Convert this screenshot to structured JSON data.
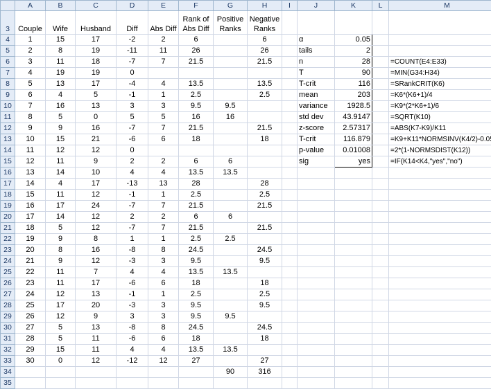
{
  "columns": [
    "A",
    "B",
    "C",
    "D",
    "E",
    "F",
    "G",
    "H",
    "I",
    "J",
    "K",
    "L",
    "M"
  ],
  "header_row": {
    "num": "3",
    "cells": [
      "Couple",
      "Wife",
      "Husband",
      "Diff",
      "Abs Diff",
      "Rank of Abs Diff",
      "Positive Ranks",
      "Negative Ranks",
      "",
      "",
      "",
      "",
      ""
    ]
  },
  "rows": [
    {
      "num": "4",
      "cells": [
        "1",
        "15",
        "17",
        "-2",
        "2",
        "6",
        "",
        "6",
        "",
        "α",
        "0.05",
        "",
        ""
      ]
    },
    {
      "num": "5",
      "cells": [
        "2",
        "8",
        "19",
        "-11",
        "11",
        "26",
        "",
        "26",
        "",
        "tails",
        "2",
        "",
        ""
      ]
    },
    {
      "num": "6",
      "cells": [
        "3",
        "11",
        "18",
        "-7",
        "7",
        "21.5",
        "",
        "21.5",
        "",
        "n",
        "28",
        "",
        "=COUNT(E4:E33)"
      ]
    },
    {
      "num": "7",
      "cells": [
        "4",
        "19",
        "19",
        "0",
        "",
        "",
        "",
        "",
        "",
        "T",
        "90",
        "",
        "=MIN(G34:H34)"
      ]
    },
    {
      "num": "8",
      "cells": [
        "5",
        "13",
        "17",
        "-4",
        "4",
        "13.5",
        "",
        "13.5",
        "",
        "T-crit",
        "116",
        "",
        "=SRankCRIT(K6)"
      ]
    },
    {
      "num": "9",
      "cells": [
        "6",
        "4",
        "5",
        "-1",
        "1",
        "2.5",
        "",
        "2.5",
        "",
        "mean",
        "203",
        "",
        "=K6*(K6+1)/4"
      ]
    },
    {
      "num": "10",
      "cells": [
        "7",
        "16",
        "13",
        "3",
        "3",
        "9.5",
        "9.5",
        "",
        "",
        "variance",
        "1928.5",
        "",
        "=K9*(2*K6+1)/6"
      ]
    },
    {
      "num": "11",
      "cells": [
        "8",
        "5",
        "0",
        "5",
        "5",
        "16",
        "16",
        "",
        "",
        "std dev",
        "43.9147",
        "",
        "=SQRT(K10)"
      ]
    },
    {
      "num": "12",
      "cells": [
        "9",
        "9",
        "16",
        "-7",
        "7",
        "21.5",
        "",
        "21.5",
        "",
        "z-score",
        "2.57317",
        "",
        "=ABS(K7-K9)/K11"
      ]
    },
    {
      "num": "13",
      "cells": [
        "10",
        "15",
        "21",
        "-6",
        "6",
        "18",
        "",
        "18",
        "",
        "T-crit",
        "116.879",
        "",
        "=K9+K11*NORMSINV(K4/2)-0.05"
      ]
    },
    {
      "num": "14",
      "cells": [
        "11",
        "12",
        "12",
        "0",
        "",
        "",
        "",
        "",
        "",
        "p-value",
        "0.01008",
        "",
        "=2*(1-NORMSDIST(K12))"
      ]
    },
    {
      "num": "15",
      "cells": [
        "12",
        "11",
        "9",
        "2",
        "2",
        "6",
        "6",
        "",
        "",
        "sig",
        "yes",
        "",
        "=IF(K14<K4,\"yes\",\"no\")"
      ]
    },
    {
      "num": "16",
      "cells": [
        "13",
        "14",
        "10",
        "4",
        "4",
        "13.5",
        "13.5",
        "",
        "",
        "",
        "",
        "",
        ""
      ]
    },
    {
      "num": "17",
      "cells": [
        "14",
        "4",
        "17",
        "-13",
        "13",
        "28",
        "",
        "28",
        "",
        "",
        "",
        "",
        ""
      ]
    },
    {
      "num": "18",
      "cells": [
        "15",
        "11",
        "12",
        "-1",
        "1",
        "2.5",
        "",
        "2.5",
        "",
        "",
        "",
        "",
        ""
      ]
    },
    {
      "num": "19",
      "cells": [
        "16",
        "17",
        "24",
        "-7",
        "7",
        "21.5",
        "",
        "21.5",
        "",
        "",
        "",
        "",
        ""
      ]
    },
    {
      "num": "20",
      "cells": [
        "17",
        "14",
        "12",
        "2",
        "2",
        "6",
        "6",
        "",
        "",
        "",
        "",
        "",
        ""
      ]
    },
    {
      "num": "21",
      "cells": [
        "18",
        "5",
        "12",
        "-7",
        "7",
        "21.5",
        "",
        "21.5",
        "",
        "",
        "",
        "",
        ""
      ]
    },
    {
      "num": "22",
      "cells": [
        "19",
        "9",
        "8",
        "1",
        "1",
        "2.5",
        "2.5",
        "",
        "",
        "",
        "",
        "",
        ""
      ]
    },
    {
      "num": "23",
      "cells": [
        "20",
        "8",
        "16",
        "-8",
        "8",
        "24.5",
        "",
        "24.5",
        "",
        "",
        "",
        "",
        ""
      ]
    },
    {
      "num": "24",
      "cells": [
        "21",
        "9",
        "12",
        "-3",
        "3",
        "9.5",
        "",
        "9.5",
        "",
        "",
        "",
        "",
        ""
      ]
    },
    {
      "num": "25",
      "cells": [
        "22",
        "11",
        "7",
        "4",
        "4",
        "13.5",
        "13.5",
        "",
        "",
        "",
        "",
        "",
        ""
      ]
    },
    {
      "num": "26",
      "cells": [
        "23",
        "11",
        "17",
        "-6",
        "6",
        "18",
        "",
        "18",
        "",
        "",
        "",
        "",
        ""
      ]
    },
    {
      "num": "27",
      "cells": [
        "24",
        "12",
        "13",
        "-1",
        "1",
        "2.5",
        "",
        "2.5",
        "",
        "",
        "",
        "",
        ""
      ]
    },
    {
      "num": "28",
      "cells": [
        "25",
        "17",
        "20",
        "-3",
        "3",
        "9.5",
        "",
        "9.5",
        "",
        "",
        "",
        "",
        ""
      ]
    },
    {
      "num": "29",
      "cells": [
        "26",
        "12",
        "9",
        "3",
        "3",
        "9.5",
        "9.5",
        "",
        "",
        "",
        "",
        "",
        ""
      ]
    },
    {
      "num": "30",
      "cells": [
        "27",
        "5",
        "13",
        "-8",
        "8",
        "24.5",
        "",
        "24.5",
        "",
        "",
        "",
        "",
        ""
      ]
    },
    {
      "num": "31",
      "cells": [
        "28",
        "5",
        "11",
        "-6",
        "6",
        "18",
        "",
        "18",
        "",
        "",
        "",
        "",
        ""
      ]
    },
    {
      "num": "32",
      "cells": [
        "29",
        "15",
        "11",
        "4",
        "4",
        "13.5",
        "13.5",
        "",
        "",
        "",
        "",
        "",
        ""
      ]
    },
    {
      "num": "33",
      "cells": [
        "30",
        "0",
        "12",
        "-12",
        "12",
        "27",
        "",
        "27",
        "",
        "",
        "",
        "",
        ""
      ]
    },
    {
      "num": "34",
      "cells": [
        "",
        "",
        "",
        "",
        "",
        "",
        "90",
        "316",
        "",
        "",
        "",
        "",
        ""
      ]
    },
    {
      "num": "35",
      "cells": [
        "",
        "",
        "",
        "",
        "",
        "",
        "",
        "",
        "",
        "",
        "",
        "",
        ""
      ]
    }
  ]
}
